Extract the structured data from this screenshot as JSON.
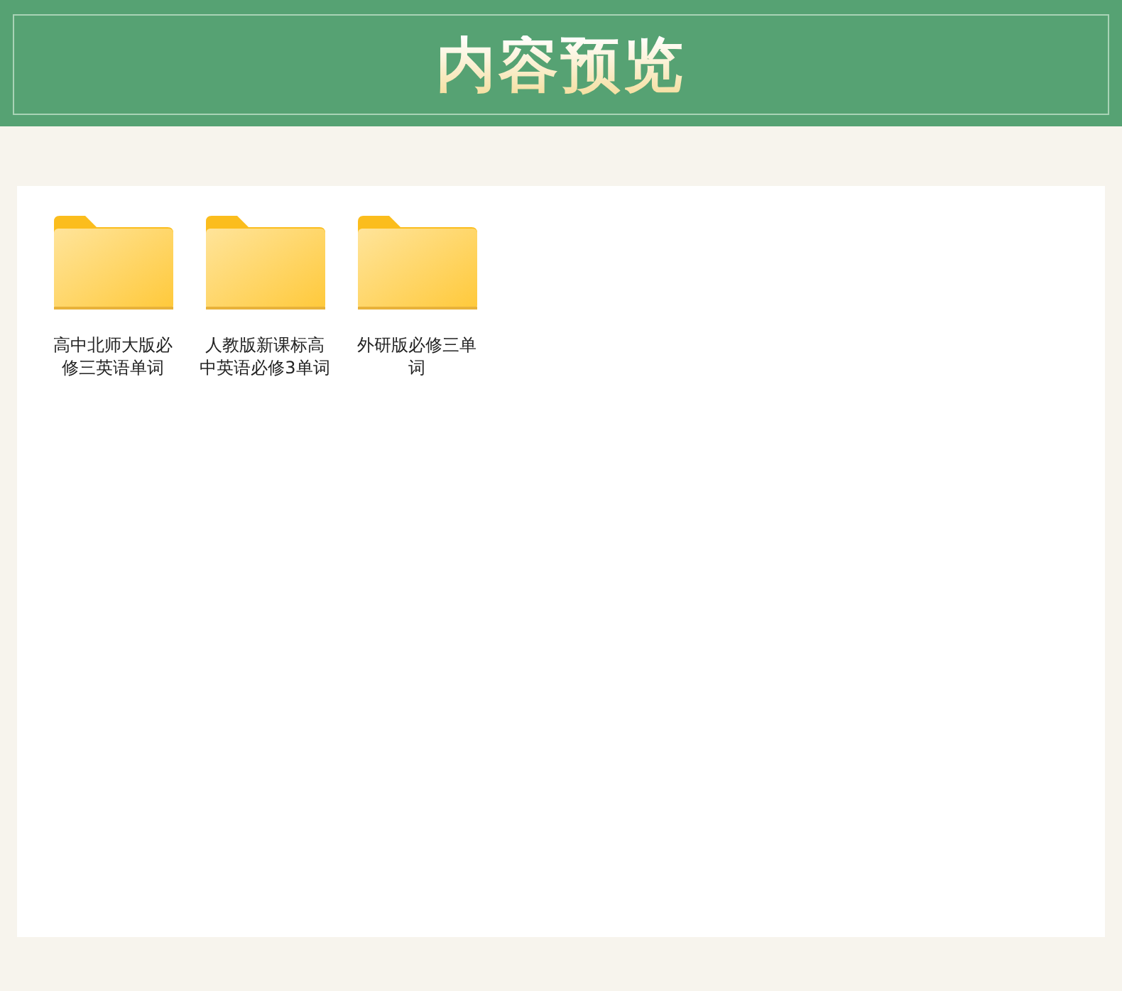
{
  "header": {
    "title": "内容预览"
  },
  "folders": [
    {
      "name": "高中北师大版必修三英语单词"
    },
    {
      "name": "人教版新课标高中英语必修3单词"
    },
    {
      "name": "外研版必修三单词"
    }
  ]
}
